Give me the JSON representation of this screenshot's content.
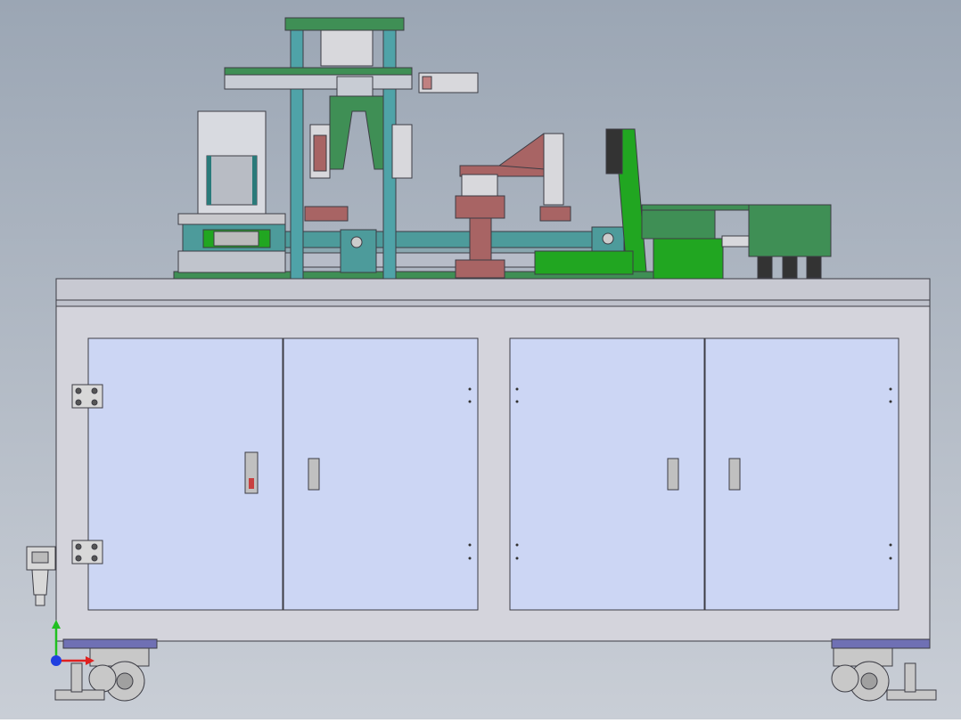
{
  "viewport": {
    "background_top": "#9ba6b4",
    "background_bottom": "#c9ced6"
  },
  "colors": {
    "cabinet_body": "#d4d4dc",
    "cabinet_top": "#c8c9d2",
    "door_fill": "#ccd6f4",
    "outline": "#3c3c44",
    "column_teal": "#4fa3a8",
    "plate_green": "#3f8f55",
    "bright_green": "#21a621",
    "brown_red": "#a86464",
    "teal_block": "#4d9b9b",
    "caster_gray": "#c8c8c8",
    "foot_blue": "#6f70b4"
  },
  "machine": {
    "cabinet_doors": [
      {
        "id": "door-1",
        "has_lock": true
      },
      {
        "id": "door-2",
        "has_lock": false
      },
      {
        "id": "door-3",
        "has_lock": false
      },
      {
        "id": "door-4",
        "has_lock": false
      }
    ],
    "casters": [
      "left",
      "right"
    ],
    "air_filter": "air-filter-regulator-icon"
  },
  "triad": {
    "axes": [
      "x-axis-arrow-icon",
      "y-axis-arrow-icon",
      "z-axis-origin-icon"
    ],
    "x_color": "#e02020",
    "y_color": "#20c020",
    "z_color": "#2040e0"
  }
}
